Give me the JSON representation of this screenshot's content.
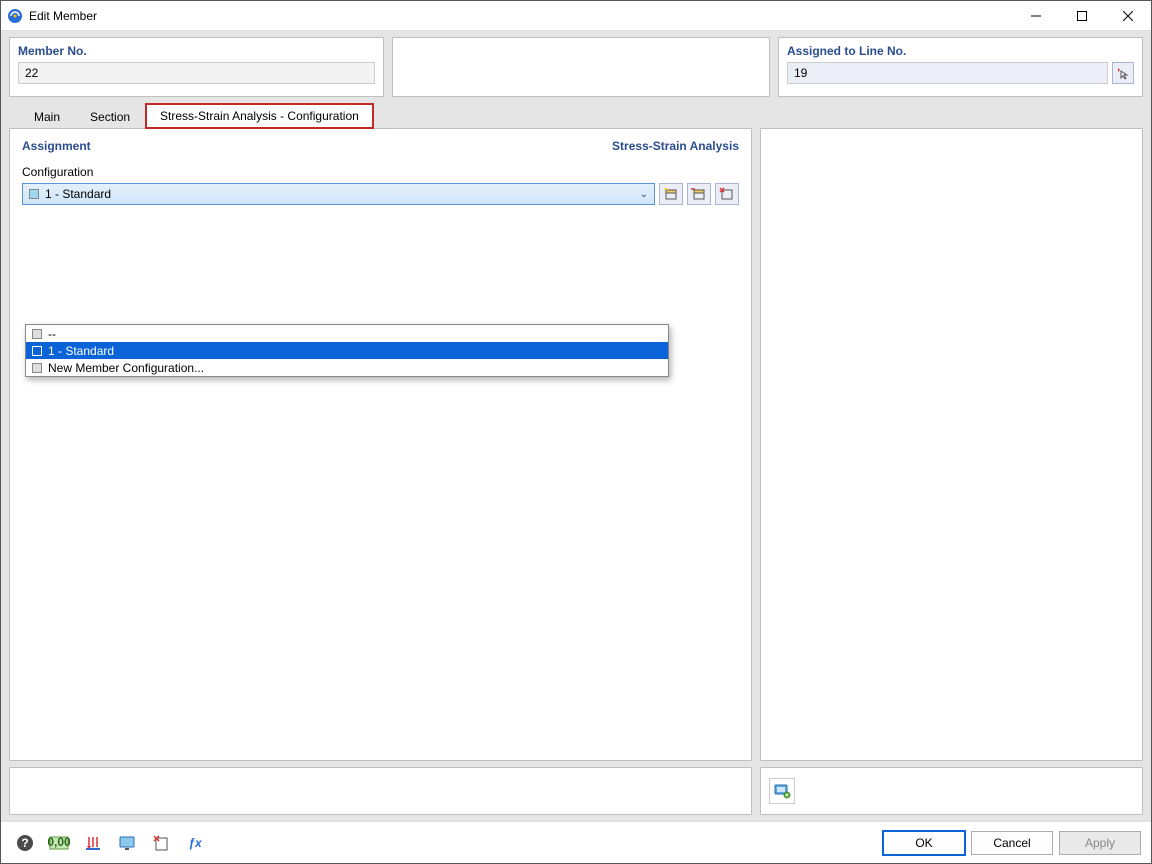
{
  "window": {
    "title": "Edit Member"
  },
  "top": {
    "member_label": "Member No.",
    "member_value": "22",
    "assigned_label": "Assigned to Line No.",
    "assigned_value": "19"
  },
  "tabs": {
    "main": "Main",
    "section": "Section",
    "stress": "Stress-Strain Analysis - Configuration"
  },
  "panel": {
    "assignment": "Assignment",
    "stress_title": "Stress-Strain Analysis",
    "config_label": "Configuration"
  },
  "combo": {
    "value": "1 - Standard",
    "options": {
      "empty": "--",
      "standard": "1 - Standard",
      "new": "New Member Configuration..."
    }
  },
  "footer": {
    "ok": "OK",
    "cancel": "Cancel",
    "apply": "Apply"
  }
}
